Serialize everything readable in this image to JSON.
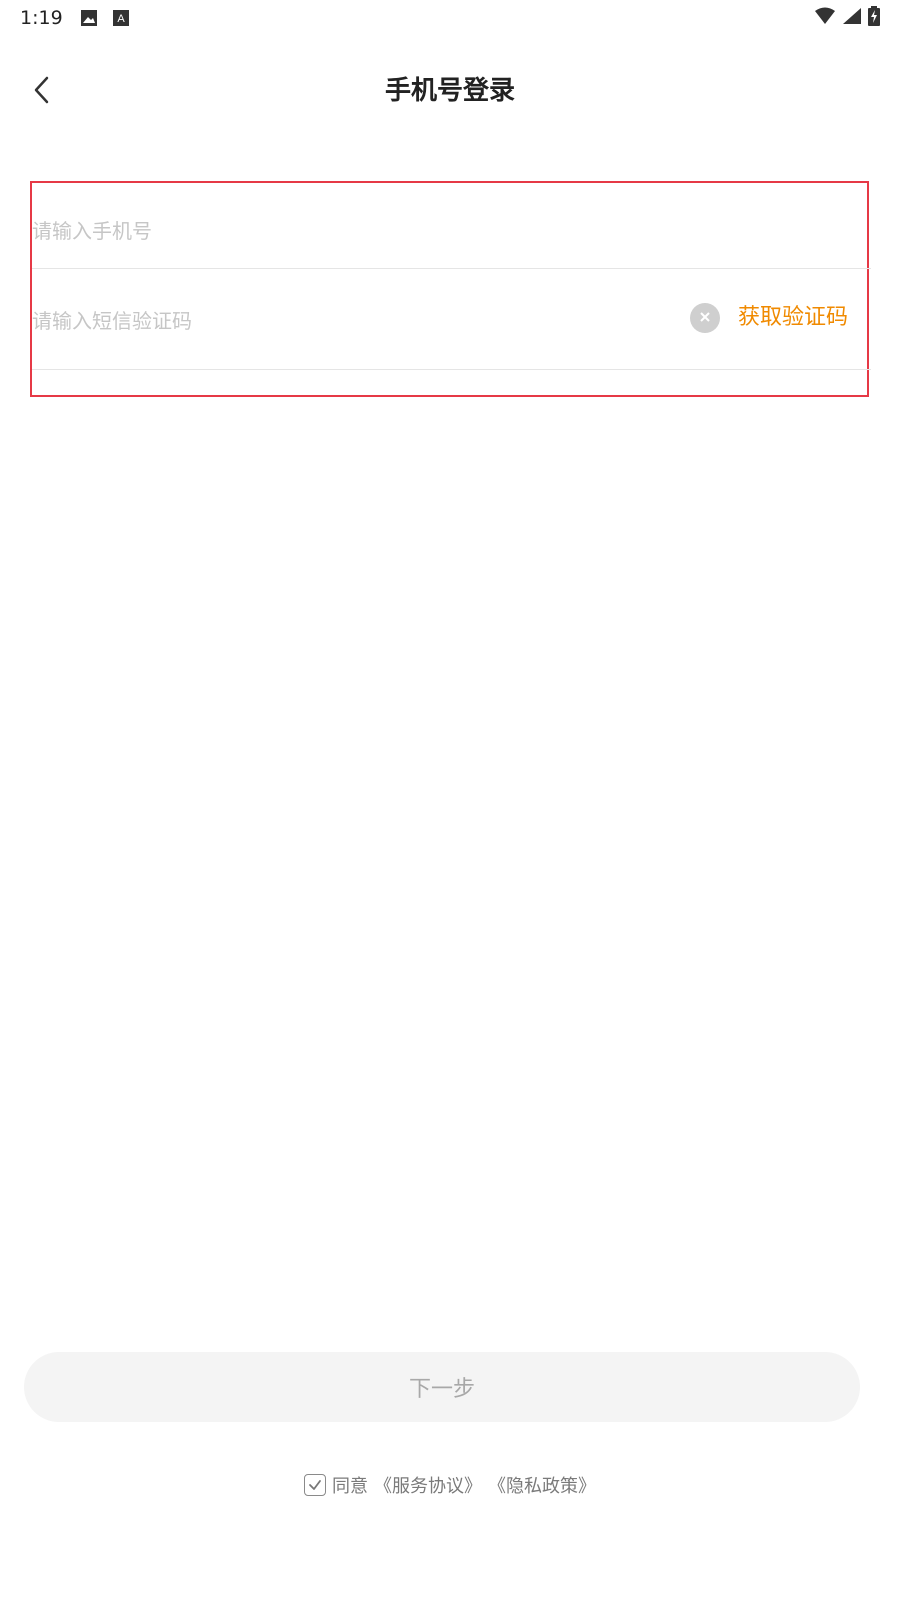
{
  "status_bar": {
    "time": "1:19",
    "icons_left": [
      "image-icon",
      "a-icon"
    ],
    "icons_right": [
      "wifi-icon",
      "cell-signal-icon",
      "battery-charging-icon"
    ]
  },
  "header": {
    "title": "手机号登录",
    "back_icon": "chevron-left-icon"
  },
  "form": {
    "phone_placeholder": "请输入手机号",
    "code_placeholder": "请输入短信验证码",
    "get_code_label": "获取验证码",
    "clear_icon": "clear-icon"
  },
  "footer": {
    "next_label": "下一步",
    "agree_prefix": "同意",
    "terms_link": "《服务协议》",
    "privacy_link": "《隐私政策》"
  },
  "colors": {
    "accent": "#f08a00",
    "highlight_border": "#e63946",
    "button_bg": "#f4f4f4"
  }
}
